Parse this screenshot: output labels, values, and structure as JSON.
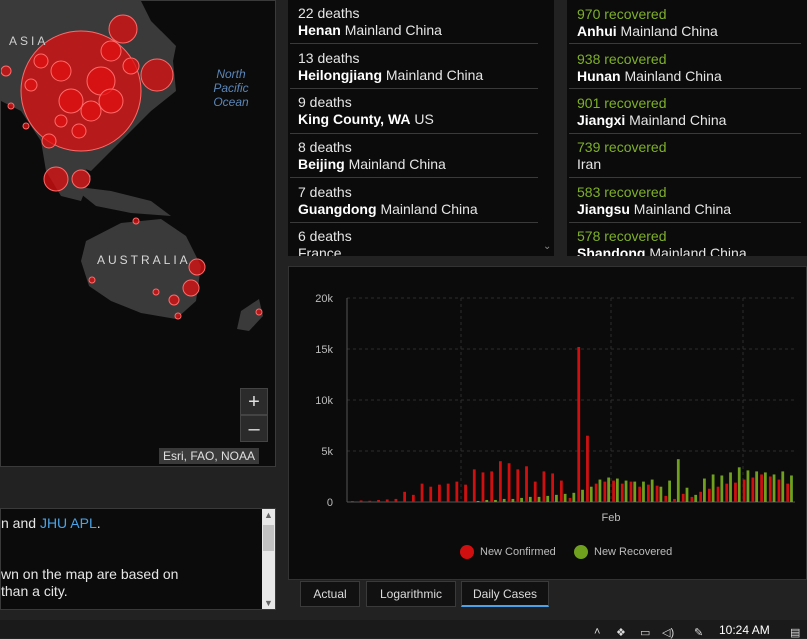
{
  "map": {
    "labels": {
      "asia": "ASIA",
      "australia": "AUSTRALIA",
      "ocean": "North Pacific Ocean"
    },
    "zoom_in": "+",
    "zoom_out": "–",
    "attribution": "Esri, FAO, NOAA",
    "bubble_color": "#e01010"
  },
  "info": {
    "line1_prefix": "n and ",
    "line1_link": "JHU APL",
    "line1_suffix": ".",
    "line2": "wn on the map are based on",
    "line3": " than a city."
  },
  "deaths": [
    {
      "value": "22 deaths",
      "name": "Henan",
      "region": "Mainland China"
    },
    {
      "value": "13 deaths",
      "name": "Heilongjiang",
      "region": "Mainland China"
    },
    {
      "value": "9 deaths",
      "name": "King County, WA",
      "region": "US"
    },
    {
      "value": "8 deaths",
      "name": "Beijing",
      "region": "Mainland China"
    },
    {
      "value": "7 deaths",
      "name": "Guangdong",
      "region": "Mainland China"
    },
    {
      "value": "6 deaths",
      "name": "",
      "region": "France"
    }
  ],
  "recovered": [
    {
      "value": "970 recovered",
      "name": "Anhui",
      "region": "Mainland China"
    },
    {
      "value": "938 recovered",
      "name": "Hunan",
      "region": "Mainland China"
    },
    {
      "value": "901 recovered",
      "name": "Jiangxi",
      "region": "Mainland China"
    },
    {
      "value": "739 recovered",
      "name": "",
      "region": "Iran"
    },
    {
      "value": "583 recovered",
      "name": "Jiangsu",
      "region": "Mainland China"
    },
    {
      "value": "578 recovered",
      "name": "Shandong",
      "region": "Mainland China"
    }
  ],
  "tabs": {
    "actual": "Actual",
    "logarithmic": "Logarithmic",
    "daily": "Daily Cases"
  },
  "taskbar": {
    "clock": "10:24 AM"
  },
  "colors": {
    "confirmed": "#d01010",
    "recovered": "#6fa01e",
    "accent": "#4aa3e8"
  },
  "chart_data": {
    "type": "bar",
    "x_tick_labels": [
      "Feb"
    ],
    "ylim": [
      0,
      20000
    ],
    "y_ticks": [
      "0",
      "5k",
      "10k",
      "15k",
      "20k"
    ],
    "grid": true,
    "legend_position": "bottom",
    "series": [
      {
        "name": "New Confirmed",
        "color": "#d01010",
        "values": [
          100,
          150,
          120,
          200,
          250,
          300,
          1000,
          700,
          1800,
          1500,
          1700,
          1800,
          2000,
          1700,
          3200,
          2900,
          3000,
          4000,
          3800,
          3200,
          3500,
          2000,
          3000,
          2800,
          2100,
          400,
          15200,
          6500,
          1800,
          2000,
          2100,
          1800,
          2000,
          1500,
          1700,
          1600,
          600,
          300,
          800,
          500,
          1000,
          1300,
          1500,
          1800,
          1900,
          2200,
          2400,
          2700,
          2500,
          2200,
          1800
        ]
      },
      {
        "name": "New Recovered",
        "color": "#6fa01e",
        "values": [
          0,
          0,
          0,
          0,
          0,
          0,
          0,
          0,
          0,
          0,
          0,
          0,
          0,
          0,
          100,
          200,
          200,
          300,
          300,
          400,
          500,
          500,
          600,
          700,
          800,
          900,
          1200,
          1500,
          2200,
          2400,
          2300,
          2100,
          2000,
          2000,
          2200,
          1500,
          2100,
          4200,
          1400,
          700,
          2300,
          2700,
          2600,
          2900,
          3400,
          3100,
          3000,
          2900,
          2700,
          3000,
          2600
        ]
      }
    ]
  }
}
